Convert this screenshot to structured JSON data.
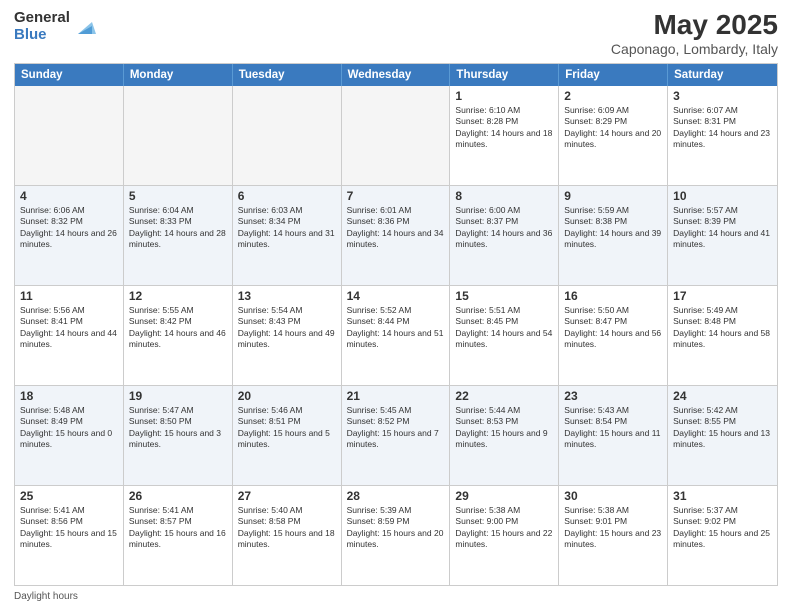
{
  "header": {
    "logo_general": "General",
    "logo_blue": "Blue",
    "month_title": "May 2025",
    "location": "Caponago, Lombardy, Italy"
  },
  "days_of_week": [
    "Sunday",
    "Monday",
    "Tuesday",
    "Wednesday",
    "Thursday",
    "Friday",
    "Saturday"
  ],
  "weeks": [
    [
      {
        "day": "",
        "sunrise": "",
        "sunset": "",
        "daylight": "",
        "empty": true
      },
      {
        "day": "",
        "sunrise": "",
        "sunset": "",
        "daylight": "",
        "empty": true
      },
      {
        "day": "",
        "sunrise": "",
        "sunset": "",
        "daylight": "",
        "empty": true
      },
      {
        "day": "",
        "sunrise": "",
        "sunset": "",
        "daylight": "",
        "empty": true
      },
      {
        "day": "1",
        "sunrise": "Sunrise: 6:10 AM",
        "sunset": "Sunset: 8:28 PM",
        "daylight": "Daylight: 14 hours and 18 minutes."
      },
      {
        "day": "2",
        "sunrise": "Sunrise: 6:09 AM",
        "sunset": "Sunset: 8:29 PM",
        "daylight": "Daylight: 14 hours and 20 minutes."
      },
      {
        "day": "3",
        "sunrise": "Sunrise: 6:07 AM",
        "sunset": "Sunset: 8:31 PM",
        "daylight": "Daylight: 14 hours and 23 minutes."
      }
    ],
    [
      {
        "day": "4",
        "sunrise": "Sunrise: 6:06 AM",
        "sunset": "Sunset: 8:32 PM",
        "daylight": "Daylight: 14 hours and 26 minutes."
      },
      {
        "day": "5",
        "sunrise": "Sunrise: 6:04 AM",
        "sunset": "Sunset: 8:33 PM",
        "daylight": "Daylight: 14 hours and 28 minutes."
      },
      {
        "day": "6",
        "sunrise": "Sunrise: 6:03 AM",
        "sunset": "Sunset: 8:34 PM",
        "daylight": "Daylight: 14 hours and 31 minutes."
      },
      {
        "day": "7",
        "sunrise": "Sunrise: 6:01 AM",
        "sunset": "Sunset: 8:36 PM",
        "daylight": "Daylight: 14 hours and 34 minutes."
      },
      {
        "day": "8",
        "sunrise": "Sunrise: 6:00 AM",
        "sunset": "Sunset: 8:37 PM",
        "daylight": "Daylight: 14 hours and 36 minutes."
      },
      {
        "day": "9",
        "sunrise": "Sunrise: 5:59 AM",
        "sunset": "Sunset: 8:38 PM",
        "daylight": "Daylight: 14 hours and 39 minutes."
      },
      {
        "day": "10",
        "sunrise": "Sunrise: 5:57 AM",
        "sunset": "Sunset: 8:39 PM",
        "daylight": "Daylight: 14 hours and 41 minutes."
      }
    ],
    [
      {
        "day": "11",
        "sunrise": "Sunrise: 5:56 AM",
        "sunset": "Sunset: 8:41 PM",
        "daylight": "Daylight: 14 hours and 44 minutes."
      },
      {
        "day": "12",
        "sunrise": "Sunrise: 5:55 AM",
        "sunset": "Sunset: 8:42 PM",
        "daylight": "Daylight: 14 hours and 46 minutes."
      },
      {
        "day": "13",
        "sunrise": "Sunrise: 5:54 AM",
        "sunset": "Sunset: 8:43 PM",
        "daylight": "Daylight: 14 hours and 49 minutes."
      },
      {
        "day": "14",
        "sunrise": "Sunrise: 5:52 AM",
        "sunset": "Sunset: 8:44 PM",
        "daylight": "Daylight: 14 hours and 51 minutes."
      },
      {
        "day": "15",
        "sunrise": "Sunrise: 5:51 AM",
        "sunset": "Sunset: 8:45 PM",
        "daylight": "Daylight: 14 hours and 54 minutes."
      },
      {
        "day": "16",
        "sunrise": "Sunrise: 5:50 AM",
        "sunset": "Sunset: 8:47 PM",
        "daylight": "Daylight: 14 hours and 56 minutes."
      },
      {
        "day": "17",
        "sunrise": "Sunrise: 5:49 AM",
        "sunset": "Sunset: 8:48 PM",
        "daylight": "Daylight: 14 hours and 58 minutes."
      }
    ],
    [
      {
        "day": "18",
        "sunrise": "Sunrise: 5:48 AM",
        "sunset": "Sunset: 8:49 PM",
        "daylight": "Daylight: 15 hours and 0 minutes."
      },
      {
        "day": "19",
        "sunrise": "Sunrise: 5:47 AM",
        "sunset": "Sunset: 8:50 PM",
        "daylight": "Daylight: 15 hours and 3 minutes."
      },
      {
        "day": "20",
        "sunrise": "Sunrise: 5:46 AM",
        "sunset": "Sunset: 8:51 PM",
        "daylight": "Daylight: 15 hours and 5 minutes."
      },
      {
        "day": "21",
        "sunrise": "Sunrise: 5:45 AM",
        "sunset": "Sunset: 8:52 PM",
        "daylight": "Daylight: 15 hours and 7 minutes."
      },
      {
        "day": "22",
        "sunrise": "Sunrise: 5:44 AM",
        "sunset": "Sunset: 8:53 PM",
        "daylight": "Daylight: 15 hours and 9 minutes."
      },
      {
        "day": "23",
        "sunrise": "Sunrise: 5:43 AM",
        "sunset": "Sunset: 8:54 PM",
        "daylight": "Daylight: 15 hours and 11 minutes."
      },
      {
        "day": "24",
        "sunrise": "Sunrise: 5:42 AM",
        "sunset": "Sunset: 8:55 PM",
        "daylight": "Daylight: 15 hours and 13 minutes."
      }
    ],
    [
      {
        "day": "25",
        "sunrise": "Sunrise: 5:41 AM",
        "sunset": "Sunset: 8:56 PM",
        "daylight": "Daylight: 15 hours and 15 minutes."
      },
      {
        "day": "26",
        "sunrise": "Sunrise: 5:41 AM",
        "sunset": "Sunset: 8:57 PM",
        "daylight": "Daylight: 15 hours and 16 minutes."
      },
      {
        "day": "27",
        "sunrise": "Sunrise: 5:40 AM",
        "sunset": "Sunset: 8:58 PM",
        "daylight": "Daylight: 15 hours and 18 minutes."
      },
      {
        "day": "28",
        "sunrise": "Sunrise: 5:39 AM",
        "sunset": "Sunset: 8:59 PM",
        "daylight": "Daylight: 15 hours and 20 minutes."
      },
      {
        "day": "29",
        "sunrise": "Sunrise: 5:38 AM",
        "sunset": "Sunset: 9:00 PM",
        "daylight": "Daylight: 15 hours and 22 minutes."
      },
      {
        "day": "30",
        "sunrise": "Sunrise: 5:38 AM",
        "sunset": "Sunset: 9:01 PM",
        "daylight": "Daylight: 15 hours and 23 minutes."
      },
      {
        "day": "31",
        "sunrise": "Sunrise: 5:37 AM",
        "sunset": "Sunset: 9:02 PM",
        "daylight": "Daylight: 15 hours and 25 minutes."
      }
    ]
  ],
  "footer": {
    "daylight_hours": "Daylight hours"
  }
}
